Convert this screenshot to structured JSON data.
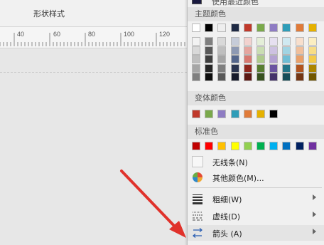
{
  "ribbon": {
    "label": "形状样式"
  },
  "ruler": {
    "labels": [
      "40",
      "60",
      "80",
      "100",
      "120"
    ]
  },
  "menu": {
    "recent_label": "使用最近颜色",
    "theme_header": "主题颜色",
    "theme_top": [
      "#ffffff",
      "#000000",
      "#eeeeee",
      "#1f2a44",
      "#c0392b",
      "#7aa94b",
      "#8e7cc3",
      "#2f9db8",
      "#e07b39",
      "#e5b100"
    ],
    "theme_columns": [
      [
        "#f2f2f2",
        "#d9d9d9",
        "#bfbfbf",
        "#a6a6a6",
        "#7f7f7f"
      ],
      [
        "#7f7f7f",
        "#595959",
        "#3f3f3f",
        "#262626",
        "#0d0d0d"
      ],
      [
        "#d9d9d9",
        "#bfbfbf",
        "#a6a6a6",
        "#7f7f7f",
        "#595959"
      ],
      [
        "#c6ccd9",
        "#8d99b3",
        "#54668c",
        "#2a3450",
        "#15192a"
      ],
      [
        "#f2d2cf",
        "#e5a59f",
        "#d87870",
        "#90261d",
        "#5c1712"
      ],
      [
        "#e4eed8",
        "#c9ddb2",
        "#aecb8c",
        "#587e32",
        "#385220"
      ],
      [
        "#e6e0f0",
        "#cdc1e1",
        "#b4a2d2",
        "#6a54a0",
        "#44336a"
      ],
      [
        "#cfe9f1",
        "#a0d4e3",
        "#70bed5",
        "#237689",
        "#164d59"
      ],
      [
        "#f8dfcd",
        "#f1bf9b",
        "#eaa06a",
        "#b2541f",
        "#743614"
      ],
      [
        "#fbeec2",
        "#f7dd86",
        "#f3cb49",
        "#ac8500",
        "#715600"
      ]
    ],
    "variant_header": "变体颜色",
    "variant_colors": [
      "#c0392b",
      "#7aa94b",
      "#8e7cc3",
      "#2f9db8",
      "#e07b39",
      "#e5b100",
      "#000000"
    ],
    "standard_header": "标准色",
    "standard_colors": [
      "#c00000",
      "#ff0000",
      "#ffc000",
      "#ffff00",
      "#92d050",
      "#00b050",
      "#00b0f0",
      "#0070c0",
      "#002060",
      "#7030a0"
    ],
    "no_line": "无线条(N)",
    "more_colors": "其他颜色(M)...",
    "weight": "粗细(W)",
    "dashes": "虚线(D)",
    "arrows": "箭头 (A)"
  },
  "icons": {
    "no_line": "empty-swatch-icon",
    "more_colors": "color-wheel-icon",
    "weight": "line-weight-icon",
    "dashes": "dash-line-icon",
    "arrows": "arrows-icon"
  },
  "colors": {
    "annotation_arrow": "#e0322b"
  }
}
